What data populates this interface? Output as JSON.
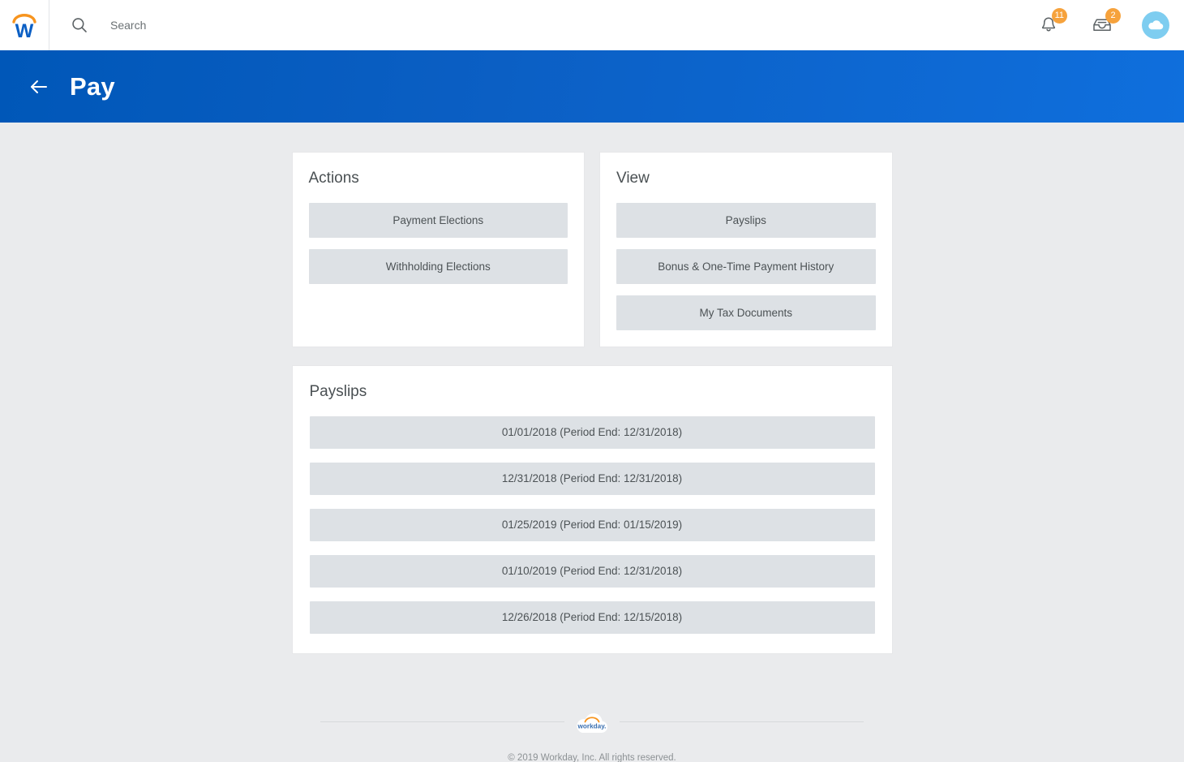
{
  "topbar": {
    "logo_icon": "workday-w-logo",
    "search_icon": "search-icon",
    "search": {
      "value": "",
      "placeholder": "Search"
    },
    "notifications": {
      "icon": "bell-icon",
      "count": "11"
    },
    "inbox": {
      "icon": "inbox-tray-icon",
      "count": "2"
    },
    "avatar": {
      "icon": "cloud-avatar-icon"
    }
  },
  "banner": {
    "back_icon": "arrow-left-icon",
    "title": "Pay",
    "accent_color": "#0057b8"
  },
  "cards": {
    "actions": {
      "title": "Actions",
      "tiles": [
        {
          "label": "Payment Elections"
        },
        {
          "label": "Withholding Elections"
        }
      ]
    },
    "view": {
      "title": "View",
      "tiles": [
        {
          "label": "Payslips"
        },
        {
          "label": "Bonus & One-Time Payment History"
        },
        {
          "label": "My Tax Documents"
        }
      ]
    },
    "payslips": {
      "title": "Payslips",
      "rows": [
        {
          "label": "01/01/2018 (Period End: 12/31/2018)"
        },
        {
          "label": "12/31/2018 (Period End: 12/31/2018)"
        },
        {
          "label": "01/25/2019 (Period End: 01/15/2019)"
        },
        {
          "label": "01/10/2019 (Period End: 12/31/2018)"
        },
        {
          "label": "12/26/2018 (Period End: 12/15/2018)"
        }
      ]
    }
  },
  "footer": {
    "logo_icon": "workday-cloud-logo",
    "logo_text": "workday.",
    "copyright": "© 2019 Workday, Inc. All rights reserved."
  },
  "colors": {
    "brand_blue": "#0b5fc4",
    "brand_orange": "#f6a23c",
    "tile_gray": "#dde1e5",
    "page_bg": "#eaebed",
    "avatar_blue": "#7ecdf0"
  }
}
